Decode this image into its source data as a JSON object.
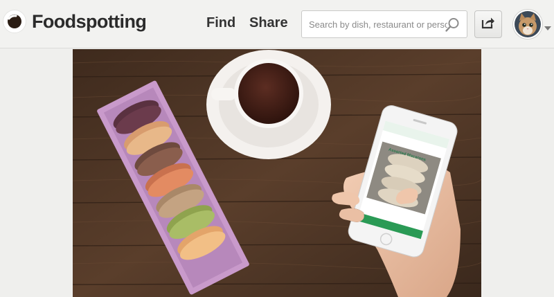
{
  "header": {
    "logo_text": "Foodspotting",
    "nav": [
      {
        "label": "Find"
      },
      {
        "label": "Share"
      }
    ],
    "search": {
      "placeholder": "Search by dish, restaurant or person",
      "value": ""
    }
  },
  "hero": {
    "phone_screen_title": "Assorted Macarons"
  },
  "icons": {
    "logo": "foodspotting-logo-icon",
    "search": "search-icon",
    "share": "share-icon",
    "avatar": "user-avatar",
    "caret": "chevron-down-icon"
  },
  "colors": {
    "header_bg": "#f2f2f0",
    "text": "#2b2b2b",
    "wood": "#4a3424",
    "box": "#c59ac8",
    "accent_green": "#2a9a55"
  }
}
